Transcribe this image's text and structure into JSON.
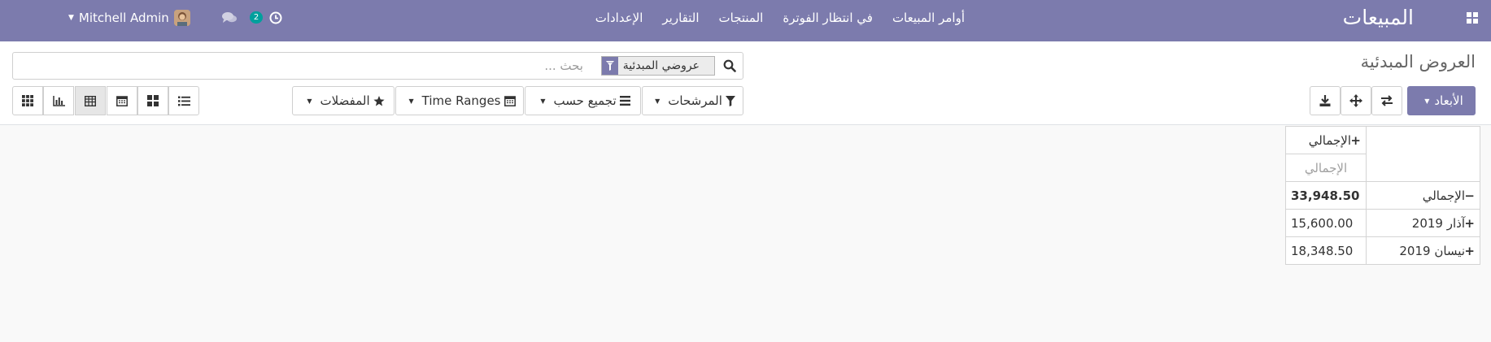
{
  "navbar": {
    "app_name": "المبيعات",
    "menu": [
      "أوامر المبيعات",
      "في انتظار الفوترة",
      "المنتجات",
      "التقارير",
      "الإعدادات"
    ],
    "user_name": "Mitchell Admin",
    "activity_count": "2",
    "colors": {
      "background": "#7c7bad",
      "badge": "#00a09d"
    }
  },
  "control_panel": {
    "title": "العروض المبدئية",
    "search": {
      "placeholder": "بحث ...",
      "facet_label": "عروضي المبدئية"
    },
    "pivot_buttons": {
      "measures_label": "الأبعاد"
    },
    "search_options": {
      "filters_label": "المرشحات",
      "group_by_label": "تجميع حسب",
      "time_ranges_label": "Time Ranges",
      "favorites_label": "المفضلات"
    },
    "views": [
      "list-view",
      "kanban-view",
      "calendar-view",
      "pivot-view",
      "graph-view",
      "dashboard-view"
    ],
    "active_view": "pivot-view"
  },
  "pivot": {
    "col_header": "الإجمالي",
    "measure_header": "الإجمالي",
    "rows": [
      {
        "label": "الإجمالي",
        "expanded": true,
        "value": "33,948.50",
        "is_total": true
      },
      {
        "label": "آذار 2019",
        "expanded": false,
        "value": "15,600.00",
        "is_total": false
      },
      {
        "label": "نيسان 2019",
        "expanded": false,
        "value": "18,348.50",
        "is_total": false
      }
    ]
  }
}
